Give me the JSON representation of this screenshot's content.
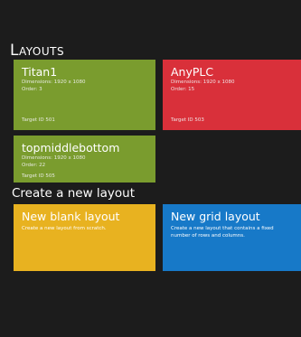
{
  "layouts_section": {
    "title": "Layouts"
  },
  "layouts": [
    {
      "name": "Titan1",
      "dimensions": "Dimensions: 1920 x 1080",
      "order": "Order: 3",
      "target": "Target ID 501",
      "color": "#7a9c2e"
    },
    {
      "name": "AnyPLC",
      "dimensions": "Dimensions: 1920 x 1080",
      "order": "Order: 15",
      "target": "Target ID 503",
      "color": "#d9303a"
    },
    {
      "name": "topmiddlebottom",
      "dimensions": "Dimensions: 1920 x 1080",
      "order": "Order: 22",
      "target": "Target ID 505",
      "color": "#7a9c2e"
    }
  ],
  "create_section": {
    "title": "Create a new layout"
  },
  "create_options": [
    {
      "title": "New blank layout",
      "description": "Create a new layout from scratch.",
      "color": "#e8b220"
    },
    {
      "title": "New grid layout",
      "description": "Create a new layout that contains a fixed number of rows and columns.",
      "color": "#1779c8"
    }
  ]
}
